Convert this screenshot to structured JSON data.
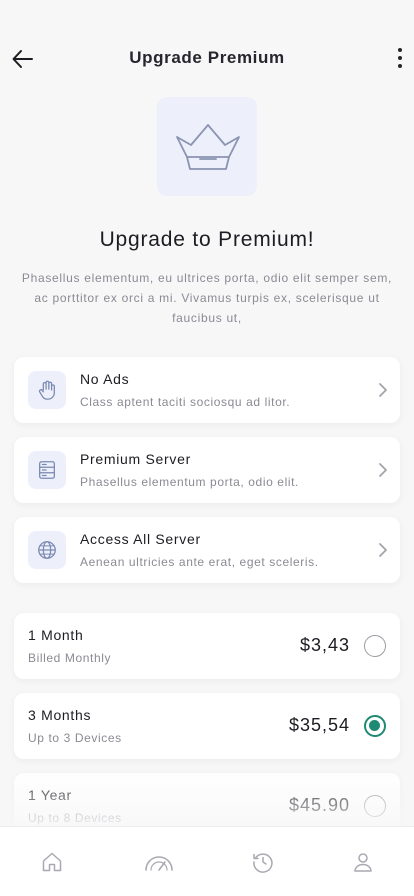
{
  "header": {
    "title": "Upgrade Premium",
    "back_icon": "arrow-left-icon",
    "more_icon": "more-vertical-icon"
  },
  "hero": {
    "icon": "crown-icon",
    "title": "Upgrade to Premium!",
    "description": "Phasellus elementum, eu ultrices porta, odio elit semper sem, ac porttitor ex orci a mi. Vivamus turpis ex, scelerisque ut faucibus ut,"
  },
  "features": [
    {
      "title": "No Ads",
      "subtitle": "Class aptent taciti sociosqu ad litor.",
      "icon": "hand-icon"
    },
    {
      "title": "Premium Server",
      "subtitle": "Phasellus elementum porta, odio elit.",
      "icon": "server-icon"
    },
    {
      "title": "Access All Server",
      "subtitle": "Aenean ultricies ante erat, eget sceleris.",
      "icon": "globe-icon"
    }
  ],
  "plans": [
    {
      "title": "1 Month",
      "subtitle": "Billed Monthly",
      "price": "$3,43",
      "selected": false
    },
    {
      "title": "3 Months",
      "subtitle": "Up to 3 Devices",
      "price": "$35,54",
      "selected": true
    },
    {
      "title": "1 Year",
      "subtitle": "Up to 8 Devices",
      "price": "$45.90",
      "selected": false
    }
  ],
  "bottom_nav": [
    {
      "icon": "home-icon"
    },
    {
      "icon": "speedometer-icon"
    },
    {
      "icon": "history-icon"
    },
    {
      "icon": "profile-icon"
    }
  ],
  "colors": {
    "accent": "#1f8a73",
    "icon_box": "#edf0fa",
    "icon_stroke": "#7b8ab3"
  }
}
